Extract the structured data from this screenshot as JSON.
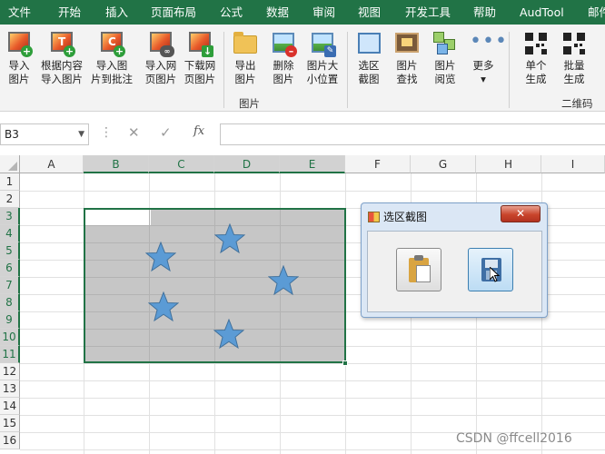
{
  "ribbon_tabs": [
    "文件",
    "开始",
    "插入",
    "页面布局",
    "公式",
    "数据",
    "审阅",
    "视图",
    "开发工具",
    "帮助",
    "AudTool",
    "邮件"
  ],
  "ribbon": {
    "buttons": [
      {
        "label1": "导入",
        "label2": "图片",
        "icon": "import-image-icon"
      },
      {
        "label1": "根据内容",
        "label2": "导入图片",
        "icon": "import-by-content-icon"
      },
      {
        "label1": "导入图",
        "label2": "片到批注",
        "icon": "import-to-comment-icon"
      },
      {
        "label1": "导入网",
        "label2": "页图片",
        "icon": "import-web-image-icon"
      },
      {
        "label1": "下载网",
        "label2": "页图片",
        "icon": "download-web-image-icon"
      },
      {
        "label1": "导出",
        "label2": "图片",
        "icon": "folder-icon"
      },
      {
        "label1": "删除",
        "label2": "图片",
        "icon": "delete-image-icon"
      },
      {
        "label1": "图片大",
        "label2": "小位置",
        "icon": "resize-image-icon"
      },
      {
        "label1": "选区",
        "label2": "截图",
        "icon": "selection-screenshot-icon"
      },
      {
        "label1": "图片",
        "label2": "查找",
        "icon": "find-image-icon"
      },
      {
        "label1": "图片",
        "label2": "阅览",
        "icon": "browse-image-icon"
      },
      {
        "label1": "更多",
        "label2": "▾",
        "icon": "more-icon"
      },
      {
        "label1": "单个",
        "label2": "生成",
        "icon": "qr-single-icon"
      },
      {
        "label1": "批量",
        "label2": "生成",
        "icon": "qr-batch-icon"
      }
    ],
    "group_labels": {
      "images": "图片",
      "qrcode": "二维码"
    }
  },
  "formula_bar": {
    "name_box": "B3",
    "fx": "fx",
    "cancel": "✕",
    "confirm": "✓",
    "formula": ""
  },
  "columns": [
    "A",
    "B",
    "C",
    "D",
    "E",
    "F",
    "G",
    "H",
    "I"
  ],
  "rows": [
    "1",
    "2",
    "3",
    "4",
    "5",
    "6",
    "7",
    "8",
    "9",
    "10",
    "11",
    "12",
    "13",
    "14",
    "15",
    "16"
  ],
  "selection": {
    "range": "B3:E11",
    "active_cell": "B3"
  },
  "dialog": {
    "title": "选区截图",
    "close": "✕",
    "buttons": [
      {
        "name": "paste"
      },
      {
        "name": "save"
      }
    ]
  },
  "colors": {
    "accent": "#217346",
    "selection_fill": "#c6c6c6",
    "star_fill": "#5b9bd5"
  },
  "watermark": "CSDN @ffcell2016"
}
